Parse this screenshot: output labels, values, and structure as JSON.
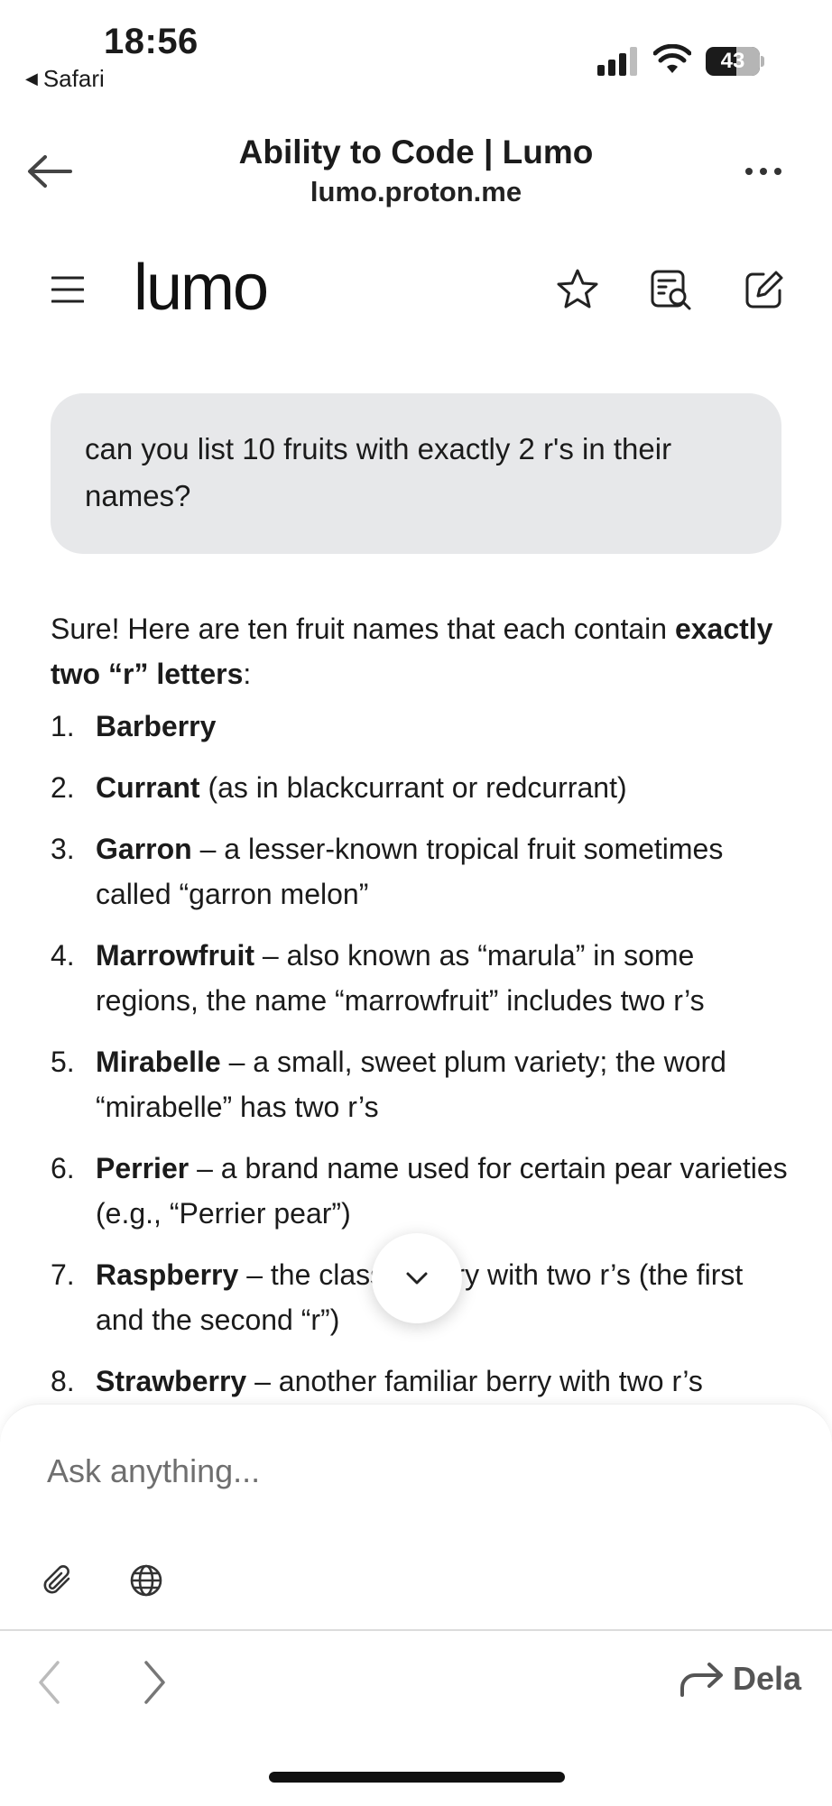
{
  "status_bar": {
    "time": "18:56",
    "back_app": "Safari",
    "battery": "43"
  },
  "browser": {
    "title": "Ability to Code | Lumo",
    "url": "lumo.proton.me"
  },
  "app": {
    "logo": "lumo"
  },
  "user_message": "can you list 10 fruits with exactly 2 r's in their names?",
  "answer": {
    "intro_plain": "Sure! Here are ten fruit names that each contain ",
    "intro_bold": "exactly two “r” letters",
    "intro_end": ":",
    "items": [
      {
        "num": "1.",
        "name": "Barberry",
        "desc": ""
      },
      {
        "num": "2.",
        "name": "Currant",
        "desc": " (as in blackcurrant or redcurrant)"
      },
      {
        "num": "3.",
        "name": "Garron",
        "desc": " – a lesser-known tropical fruit sometimes called “garron melon”"
      },
      {
        "num": "4.",
        "name": "Marrowfruit",
        "desc": " – also known as “marula” in some regions, the name “marrowfruit” includes two r’s"
      },
      {
        "num": "5.",
        "name": "Mirabelle",
        "desc": " – a small, sweet plum variety; the word “mirabelle” has two r’s"
      },
      {
        "num": "6.",
        "name": "Perrier",
        "desc": " – a brand name used for certain pear varieties (e.g., “Perrier pear”)"
      },
      {
        "num": "7.",
        "name": "Raspberry",
        "desc": " – the classic berry with two r’s (the first and the second “r”)"
      },
      {
        "num": "8.",
        "name": "Strawberry",
        "desc": " – another familiar berry with two r’s"
      }
    ]
  },
  "composer": {
    "placeholder": "Ask anything..."
  },
  "bottom_bar": {
    "share_label": "Dela"
  },
  "icons": [
    "back-arrow-icon",
    "more-icon",
    "hamburger-icon",
    "star-icon",
    "search-document-icon",
    "compose-icon",
    "chevron-down-icon",
    "paperclip-icon",
    "globe-icon",
    "chevron-left-icon",
    "chevron-right-icon",
    "share-arrow-icon"
  ]
}
